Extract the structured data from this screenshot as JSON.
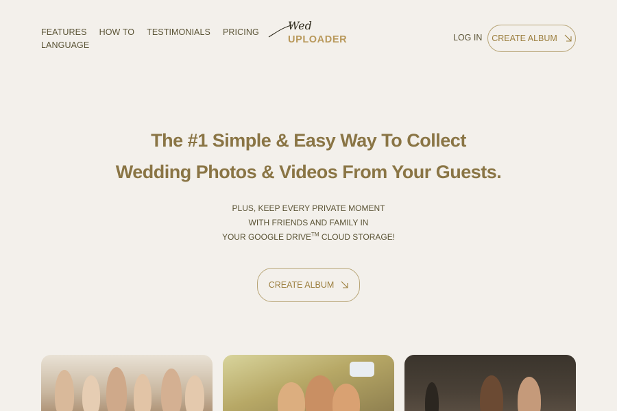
{
  "nav": {
    "items": [
      "FEATURES",
      "HOW TO",
      "TESTIMONIALS",
      "PRICING",
      "LANGUAGE"
    ]
  },
  "logo": {
    "script": "Wed",
    "main": "UPLOADER"
  },
  "header": {
    "login_label": "LOG IN",
    "create_album_label": "CREATE ALBUM",
    "arrow_icon": "arrow-down-right-icon"
  },
  "hero": {
    "title_line1": "The #1 Simple & Easy Way To Collect",
    "title_line2": "Wedding Photos & Videos From Your Guests.",
    "sub_line1": "PLUS, KEEP EVERY PRIVATE MOMENT",
    "sub_line2": "WITH FRIENDS AND FAMILY IN",
    "sub_line3_pre": "YOUR GOOGLE DRIVE",
    "sub_line3_tm": "TM",
    "sub_line3_post": " CLOUD STORAGE!",
    "cta_label": "CREATE ALBUM"
  },
  "colors": {
    "background": "#f3f0eb",
    "accent": "#b8985a",
    "title": "#8a7545",
    "text": "#5b5436"
  }
}
